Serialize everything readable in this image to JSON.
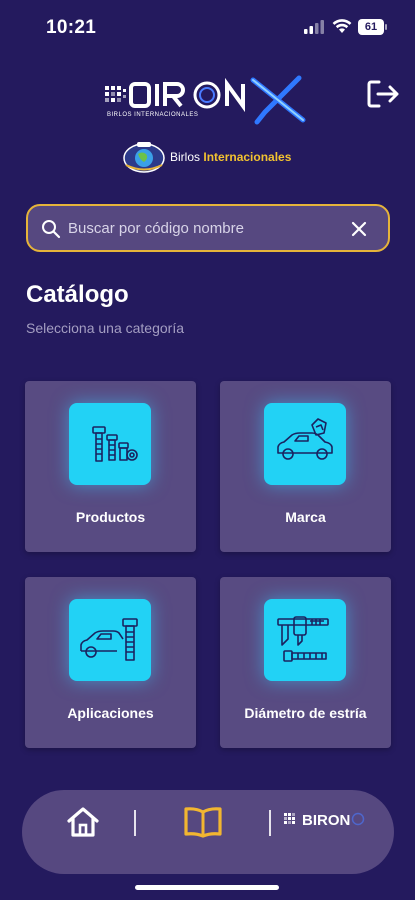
{
  "status_bar": {
    "time": "10:21",
    "battery": "61"
  },
  "header": {
    "brand_wordmark": "BIRONX",
    "brand_tagline": "BIRLOS INTERNACIONALES",
    "logout_icon": "logout-icon"
  },
  "partner": {
    "name_part1": "Birlos",
    "name_part2": "Internacionales",
    "emblem_icon": "globe-emblem-icon"
  },
  "search": {
    "placeholder": "Buscar por código nombre",
    "value": "",
    "icon": "search-icon",
    "clear_icon": "close-icon"
  },
  "catalog": {
    "title": "Catálogo",
    "subtitle": "Selecciona una categoría",
    "categories": [
      {
        "label": "Productos",
        "icon": "bolts-icon"
      },
      {
        "label": "Marca",
        "icon": "car-brand-icon"
      },
      {
        "label": "Aplicaciones",
        "icon": "car-bolt-icon"
      },
      {
        "label": "Diámetro de estría",
        "icon": "caliper-icon"
      }
    ]
  },
  "bottom_nav": {
    "items": [
      {
        "name": "home",
        "icon": "home-icon",
        "active": false
      },
      {
        "name": "catalog",
        "icon": "book-icon",
        "active": true
      },
      {
        "name": "brand",
        "label": "BIRON",
        "icon": "bironx-logo-icon",
        "active": false
      }
    ]
  },
  "colors": {
    "background": "#241a5e",
    "card": "#584b82",
    "icon_tile": "#22d2f5",
    "accent": "#e6b43a",
    "nav_active": "#f2b630"
  }
}
